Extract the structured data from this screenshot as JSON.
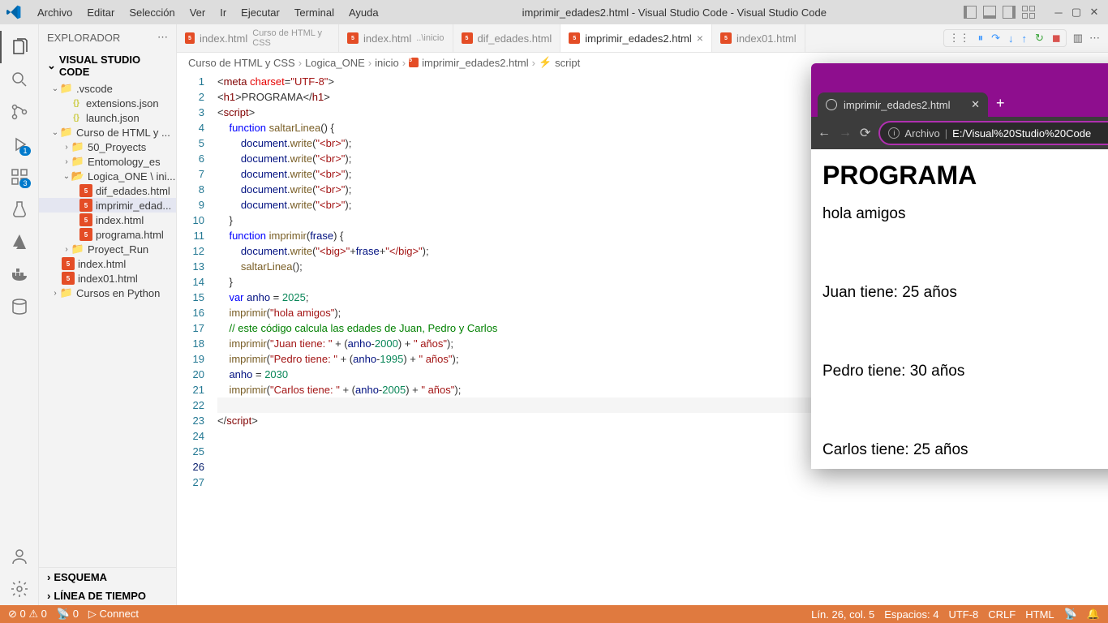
{
  "titlebar": {
    "menus": [
      "Archivo",
      "Editar",
      "Selección",
      "Ver",
      "Ir",
      "Ejecutar",
      "Terminal",
      "Ayuda"
    ],
    "title": "imprimir_edades2.html - Visual Studio Code - Visual Studio Code"
  },
  "activityBadges": {
    "debug": "1",
    "ext": "3"
  },
  "sidebar": {
    "title": "EXPLORADOR",
    "workspace": "VISUAL STUDIO CODE",
    "tree": {
      "vscode": ".vscode",
      "extensions": "extensions.json",
      "launch": "launch.json",
      "curso": "Curso de HTML y ...",
      "proyects50": "50_Proyects",
      "entomology": "Entomology_es",
      "logica": "Logica_ONE \\ ini...",
      "dif": "dif_edades.html",
      "imprimir": "imprimir_edad...",
      "index": "index.html",
      "programa": "programa.html",
      "proyectrun": "Proyect_Run",
      "index2": "index.html",
      "index01": "index01.html",
      "cursospy": "Cursos en Python"
    },
    "esquema": "ESQUEMA",
    "timeline": "LÍNEA DE TIEMPO"
  },
  "tabs": [
    {
      "name": "index.html",
      "desc": "Curso de HTML y CSS"
    },
    {
      "name": "index.html",
      "desc": "..\\inicio"
    },
    {
      "name": "dif_edades.html",
      "desc": ""
    },
    {
      "name": "imprimir_edades2.html",
      "desc": "",
      "active": true
    },
    {
      "name": "index01.html",
      "desc": ""
    }
  ],
  "breadcrumbs": [
    "Curso de HTML y CSS",
    "Logica_ONE",
    "inicio",
    "imprimir_edades2.html",
    "script"
  ],
  "code": {
    "lines": 27,
    "current": 26
  },
  "browser": {
    "tabTitle": "imprimir_edades2.html",
    "addressLabel": "Archivo",
    "addressPath": "E:/Visual%20Studio%20Code",
    "h1": "PROGRAMA",
    "lines": [
      "hola amigos",
      "Juan tiene: 25 años",
      "Pedro tiene: 30 años",
      "Carlos tiene: 25 años"
    ]
  },
  "status": {
    "errors": "0",
    "warnings": "0",
    "ports": "0",
    "connect": "Connect",
    "pos": "Lín. 26, col. 5",
    "spaces": "Espacios: 4",
    "enc": "UTF-8",
    "eol": "CRLF",
    "lang": "HTML"
  }
}
